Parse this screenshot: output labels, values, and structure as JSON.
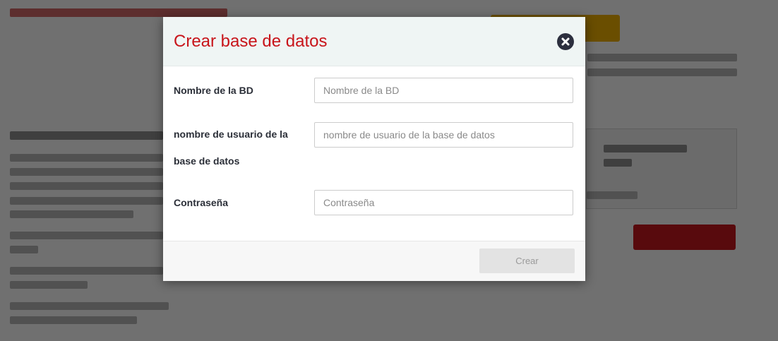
{
  "modal": {
    "title": "Crear base de datos",
    "close_icon": "close-circle-icon",
    "fields": [
      {
        "label": "Nombre de la BD",
        "placeholder": "Nombre de la BD",
        "value": ""
      },
      {
        "label": "nombre de usuario de la base de datos",
        "placeholder": "nombre de usuario de la base de datos",
        "value": ""
      },
      {
        "label": "Contraseña",
        "placeholder": "Contraseña",
        "value": ""
      }
    ],
    "submit_label": "Crear"
  },
  "colors": {
    "title": "#c8141a",
    "header_bg": "#eff5f4",
    "close_button": "#2c2f3e",
    "disabled_button_bg": "#e3e3e3",
    "overlay": "rgba(0,0,0,0.56)"
  }
}
